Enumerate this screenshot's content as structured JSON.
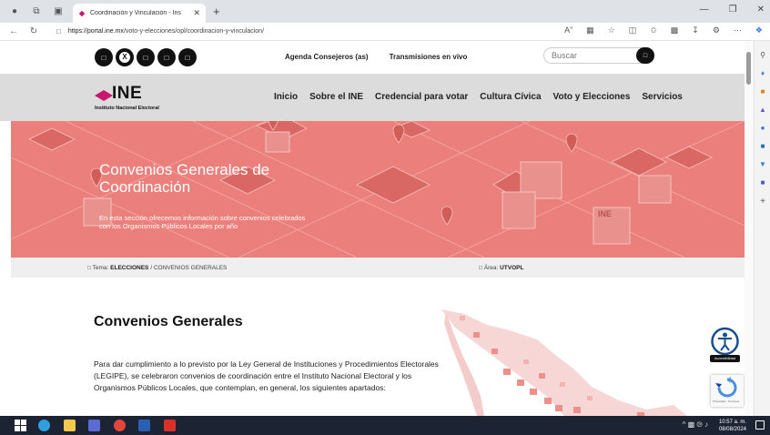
{
  "browser": {
    "tab_title": "Coordinación y Vinculación - Ins",
    "url_domain": "https://portal.ine.mx",
    "url_path": "/voto-y-elecciones/opl/coordinacion-y-vinculacion/"
  },
  "site": {
    "top_links": [
      "Agenda Consejeros (as)",
      "Transmisiones en vivo"
    ],
    "search_placeholder": "Buscar",
    "logo_name": "INE",
    "logo_subtitle": "Instituto Nacional Electoral",
    "menu": [
      "Inicio",
      "Sobre el INE",
      "Credencial para votar",
      "Cultura Cívica",
      "Voto y Elecciones",
      "Servicios"
    ]
  },
  "hero": {
    "title": "Convenios Generales de Coordinación",
    "text": "En esta sección ofrecemos información sobre convenios celebrados con los Organismos Públicos Locales por año"
  },
  "breadcrumb": {
    "tema_label": "Tema:",
    "tema_section": "ELECCIONES",
    "separator": "/",
    "tema_page": "CONVENIOS GENERALES",
    "area_label": "Área:",
    "area_value": "UTVOPL"
  },
  "content": {
    "title": "Convenios Generales",
    "paragraph": "Para dar cumplimiento a lo previsto por la Ley General de Instituciones y Procedimientos Electorales (LEGIPE), se celebraron convenios de coordinación entre el Instituto Nacional Electoral y los Organismos Públicos Locales, que contemplan, en general, los siguientes apartados:"
  },
  "widgets": {
    "accessibility_label": "Accesibilidad",
    "recaptcha_text": "Privacidad - Términos"
  },
  "taskbar": {
    "time": "10:57 a. m.",
    "date": "08/08/2024"
  },
  "colors": {
    "hero": "#ea7f7b",
    "ine_pink": "#c8176c"
  }
}
